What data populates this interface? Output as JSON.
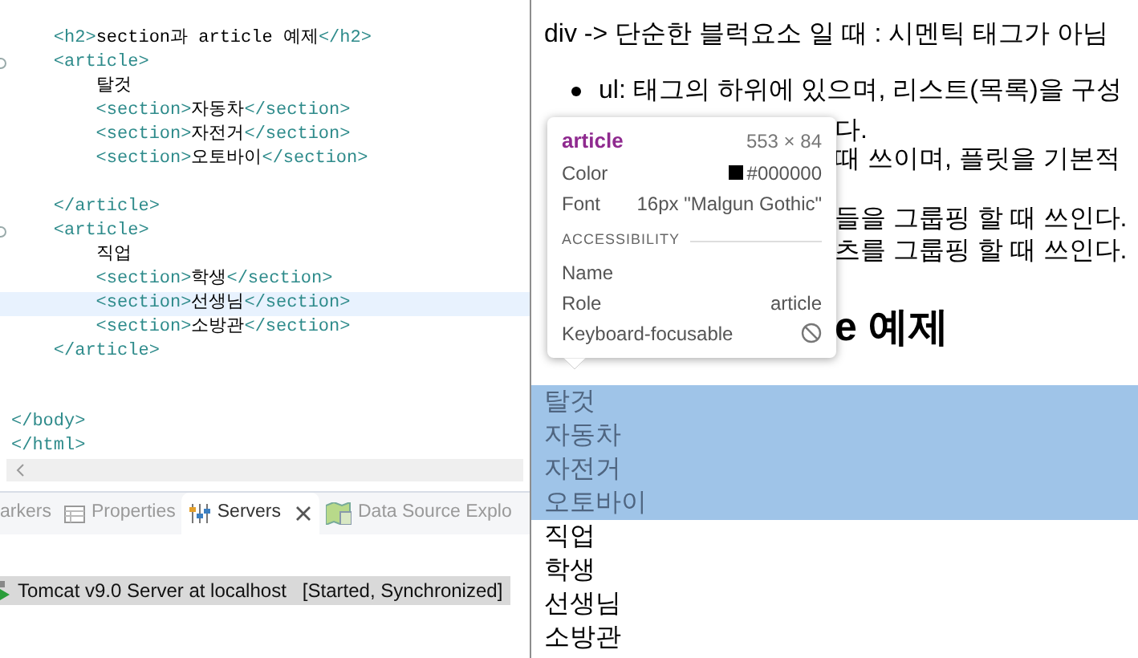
{
  "editor": {
    "lines": [
      {
        "kind": "code",
        "fold": false,
        "selected": false,
        "segments": [
          {
            "kind": "tag",
            "text": "    <h2>"
          },
          {
            "kind": "text",
            "text": "section과 article 예제"
          },
          {
            "kind": "tag",
            "text": "</h2>"
          }
        ]
      },
      {
        "kind": "code",
        "fold": true,
        "selected": false,
        "segments": [
          {
            "kind": "tag",
            "text": "    <article>"
          }
        ]
      },
      {
        "kind": "code",
        "fold": false,
        "selected": false,
        "segments": [
          {
            "kind": "text",
            "text": "        탈것"
          }
        ]
      },
      {
        "kind": "code",
        "fold": false,
        "selected": false,
        "segments": [
          {
            "kind": "tag",
            "text": "        <section>"
          },
          {
            "kind": "text",
            "text": "자동차"
          },
          {
            "kind": "tag",
            "text": "</section>"
          }
        ]
      },
      {
        "kind": "code",
        "fold": false,
        "selected": false,
        "segments": [
          {
            "kind": "tag",
            "text": "        <section>"
          },
          {
            "kind": "text",
            "text": "자전거"
          },
          {
            "kind": "tag",
            "text": "</section>"
          }
        ]
      },
      {
        "kind": "code",
        "fold": false,
        "selected": false,
        "segments": [
          {
            "kind": "tag",
            "text": "        <section>"
          },
          {
            "kind": "text",
            "text": "오토바이"
          },
          {
            "kind": "tag",
            "text": "</section>"
          }
        ]
      },
      {
        "kind": "blank"
      },
      {
        "kind": "code",
        "fold": false,
        "selected": false,
        "segments": [
          {
            "kind": "tag",
            "text": "    </article>"
          }
        ]
      },
      {
        "kind": "code",
        "fold": true,
        "selected": false,
        "segments": [
          {
            "kind": "tag",
            "text": "    <article>"
          }
        ]
      },
      {
        "kind": "code",
        "fold": false,
        "selected": false,
        "segments": [
          {
            "kind": "text",
            "text": "        직업"
          }
        ]
      },
      {
        "kind": "code",
        "fold": false,
        "selected": false,
        "segments": [
          {
            "kind": "tag",
            "text": "        <section>"
          },
          {
            "kind": "text",
            "text": "학생"
          },
          {
            "kind": "tag",
            "text": "</section>"
          }
        ]
      },
      {
        "kind": "code",
        "fold": false,
        "selected": true,
        "segments": [
          {
            "kind": "tag",
            "text": "        <section>"
          },
          {
            "kind": "text",
            "text": "선생님"
          },
          {
            "kind": "tag",
            "text": "</section>"
          }
        ]
      },
      {
        "kind": "code",
        "fold": false,
        "selected": false,
        "segments": [
          {
            "kind": "tag",
            "text": "        <section>"
          },
          {
            "kind": "text",
            "text": "소방관"
          },
          {
            "kind": "tag",
            "text": "</section>"
          }
        ]
      },
      {
        "kind": "code",
        "fold": false,
        "selected": false,
        "segments": [
          {
            "kind": "tag",
            "text": "    </article>"
          }
        ]
      },
      {
        "kind": "blank"
      },
      {
        "kind": "blank"
      },
      {
        "kind": "code",
        "fold": false,
        "selected": false,
        "segments": [
          {
            "kind": "tag",
            "text": "</body>"
          }
        ]
      },
      {
        "kind": "code",
        "fold": false,
        "selected": false,
        "segments": [
          {
            "kind": "tag",
            "text": "</html>"
          }
        ]
      }
    ]
  },
  "panel_tabs": [
    {
      "kind": "markers",
      "label": "arkers",
      "selected": false,
      "closable": false
    },
    {
      "kind": "properties",
      "label": "Properties",
      "selected": false,
      "closable": false
    },
    {
      "kind": "servers",
      "label": "Servers",
      "selected": true,
      "closable": true
    },
    {
      "kind": "datasource",
      "label": "Data Source Explo",
      "selected": false,
      "closable": false
    }
  ],
  "servers": [
    {
      "name": "Tomcat v9.0 Server at localhost",
      "state": "[Started, Synchronized]",
      "selected": true
    }
  ],
  "browser": {
    "intro": "div -> 단순한 블럭요소 일 때 : 시멘틱 태그가 아님",
    "bullet": "ul: 태그의 하위에 있으며, 리스트(목록)을 구성",
    "fragments": [
      "다.",
      "때 쓰이며, 플릿을 기본적",
      "들을 그룹핑 할 때 쓰인다.",
      "츠를 그룹핑 할 때 쓰인다."
    ],
    "heading_fragment": "e 예제",
    "articles": [
      {
        "highlighted": true,
        "heading": "탈것",
        "sections": [
          "자동차",
          "자전거",
          "오토바이"
        ]
      },
      {
        "highlighted": false,
        "heading": "직업",
        "sections": [
          "학생",
          "선생님",
          "소방관"
        ]
      }
    ]
  },
  "inspector_tooltip": {
    "tag": "article",
    "size": "553 × 84",
    "rows": [
      {
        "kind": "color",
        "label": "Color",
        "value": "#000000"
      },
      {
        "kind": "text",
        "label": "Font",
        "value": "16px \"Malgun Gothic\""
      }
    ],
    "section": "ACCESSIBILITY",
    "accessibility": [
      {
        "kind": "text",
        "label": "Name"
      },
      {
        "kind": "text",
        "label": "Role",
        "value": "article"
      },
      {
        "kind": "blocked",
        "label": "Keyboard-focusable"
      }
    ]
  }
}
